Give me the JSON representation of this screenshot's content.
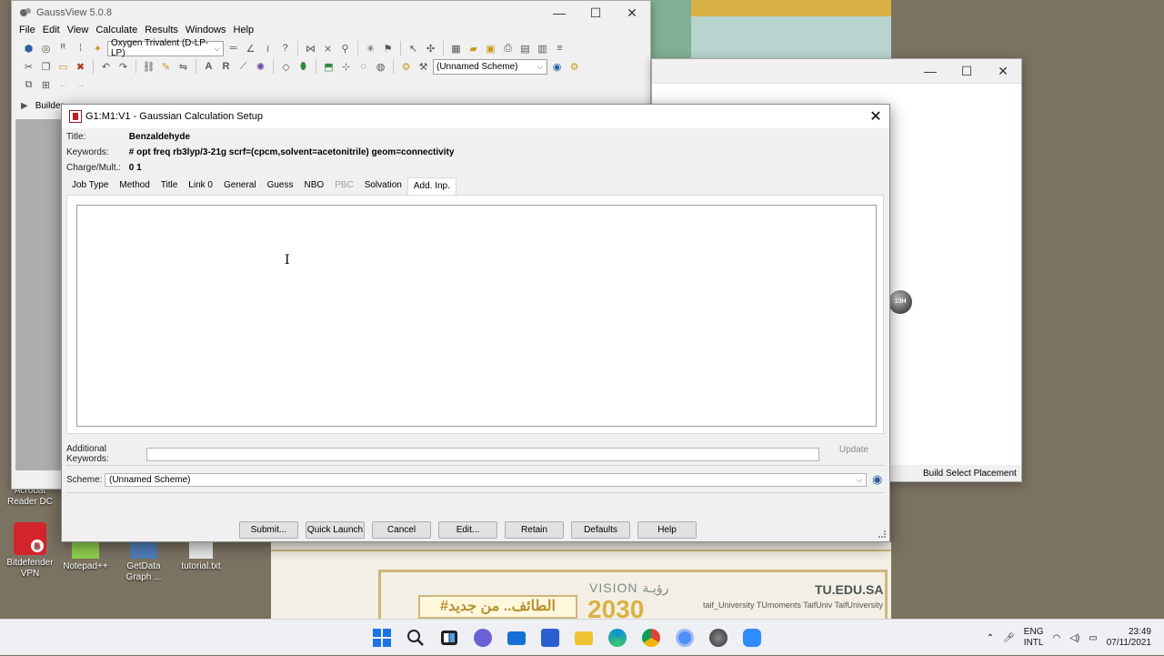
{
  "desktop": {
    "icons": [
      {
        "name": "acrobat",
        "label": "Acrobat Reader DC"
      },
      {
        "name": "bitdefender-vpn",
        "label": "Bitdefender VPN"
      },
      {
        "name": "notepad-plus-plus",
        "label": "Notepad++"
      },
      {
        "name": "getdata-graph",
        "label": "GetData Graph ..."
      },
      {
        "name": "tutorial-txt",
        "label": "tutorial.txt"
      }
    ],
    "banner": {
      "vision": "VISION رؤيـة",
      "year": "2030",
      "arabic_tag": "#الطائف.. من جديد",
      "site": "TU.EDU.SA",
      "handles": "taif_University   TUmoments   TaifUniv   TaifUniversity"
    }
  },
  "gaussview": {
    "title": "GaussView 5.0.8",
    "menu": [
      "File",
      "Edit",
      "View",
      "Calculate",
      "Results",
      "Windows",
      "Help"
    ],
    "element_select": "Oxygen Trivalent (D-LP-LP)",
    "scheme_select": "(Unnamed Scheme)",
    "builder_label": "Builder"
  },
  "second_window": {
    "atom_label": "13H",
    "status": "Build  Select Placement"
  },
  "dialog": {
    "title": "G1:M1:V1 - Gaussian Calculation Setup",
    "title_label": "Title:",
    "title_value": "Benzaldehyde",
    "keywords_label": "Keywords:",
    "keywords_value": "# opt freq rb3lyp/3-21g scrf=(cpcm,solvent=acetonitrile) geom=connectivity",
    "charge_label": "Charge/Mult.:",
    "charge_value": "0 1",
    "tabs": [
      {
        "label": "Job Type",
        "state": "normal"
      },
      {
        "label": "Method",
        "state": "normal"
      },
      {
        "label": "Title",
        "state": "normal"
      },
      {
        "label": "Link 0",
        "state": "normal"
      },
      {
        "label": "General",
        "state": "normal"
      },
      {
        "label": "Guess",
        "state": "normal"
      },
      {
        "label": "NBO",
        "state": "normal"
      },
      {
        "label": "PBC",
        "state": "disabled"
      },
      {
        "label": "Solvation",
        "state": "normal"
      },
      {
        "label": "Add. Inp.",
        "state": "active"
      }
    ],
    "additional_input": "",
    "additional_keywords_label": "Additional Keywords:",
    "additional_keywords_value": "",
    "update_label": "Update",
    "scheme_label": "Scheme:",
    "scheme_value": "(Unnamed Scheme)",
    "buttons": [
      "Submit...",
      "Quick Launch",
      "Cancel",
      "Edit...",
      "Retain",
      "Defaults",
      "Help"
    ]
  },
  "taskbar": {
    "lang_top": "ENG",
    "lang_bottom": "INTL",
    "time": "23:49",
    "date": "07/11/2021"
  }
}
